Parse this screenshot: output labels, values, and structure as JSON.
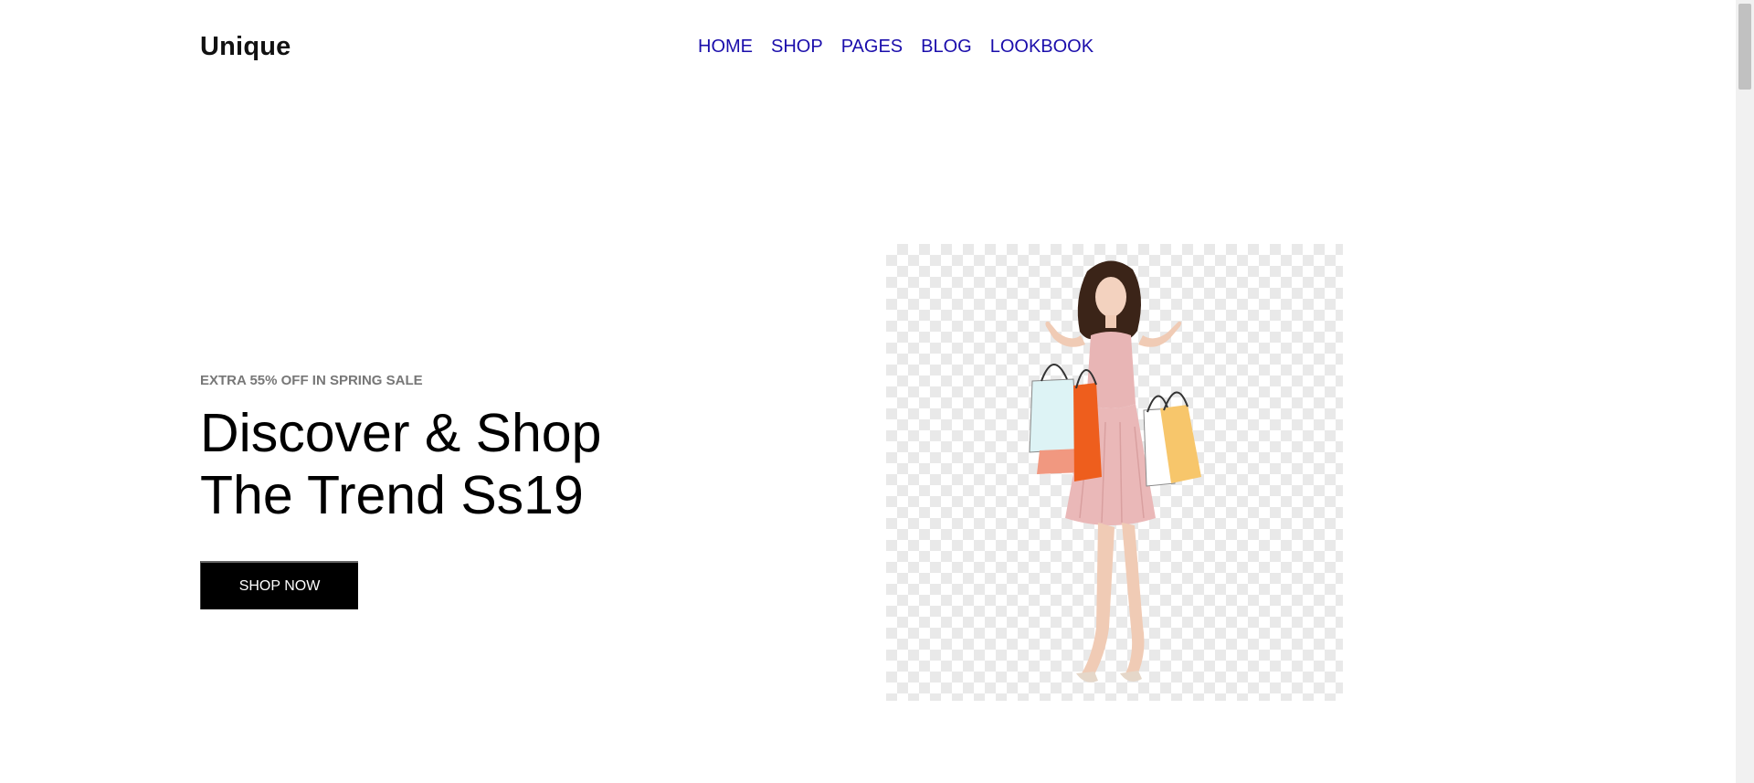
{
  "header": {
    "logo": "Unique",
    "nav": [
      {
        "label": "HOME"
      },
      {
        "label": "SHOP"
      },
      {
        "label": "PAGES"
      },
      {
        "label": "BLOG"
      },
      {
        "label": "LOOKBOOK"
      }
    ]
  },
  "hero": {
    "eyebrow": "EXTRA 55% OFF IN SPRING SALE",
    "headline_line1": "Discover & Shop",
    "headline_line2": "The Trend Ss19",
    "cta_label": "SHOP NOW",
    "image_icon": "woman-with-shopping-bags-illustration"
  },
  "colors": {
    "nav_link": "#1a0dab",
    "button_bg": "#000000",
    "eyebrow": "#777777"
  }
}
